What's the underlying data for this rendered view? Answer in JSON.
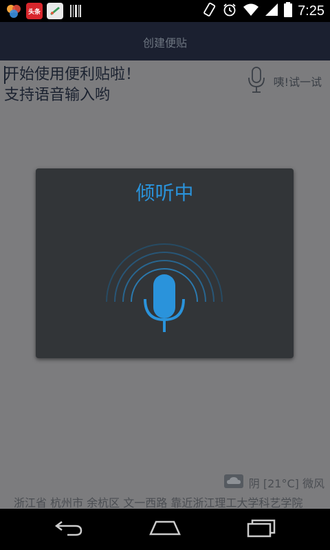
{
  "status_bar": {
    "time": "7:25",
    "app_icons": [
      "colorful-bubbles-icon",
      "toutiao-news-icon",
      "green-app-icon",
      "barcode-icon"
    ],
    "toutiao_label": "头条",
    "system_icons": [
      "phone-rotate-icon",
      "alarm-icon",
      "wifi-icon",
      "signal-icon",
      "battery-icon"
    ]
  },
  "header": {
    "title": "创建便贴"
  },
  "note": {
    "line1": "开始使用便利贴啦！",
    "line2": "支持语音输入哟"
  },
  "voice_try": {
    "label": "咦!试一试"
  },
  "dialog": {
    "title": "倾听中"
  },
  "footer": {
    "weather": "阴 [21°C] 微风",
    "address": "浙江省 杭州市 余杭区 文一西路 靠近浙江理工大学科艺学院"
  },
  "colors": {
    "accent": "#2a93db",
    "title_bar": "#1b2030",
    "dialog_bg": "#323538"
  }
}
